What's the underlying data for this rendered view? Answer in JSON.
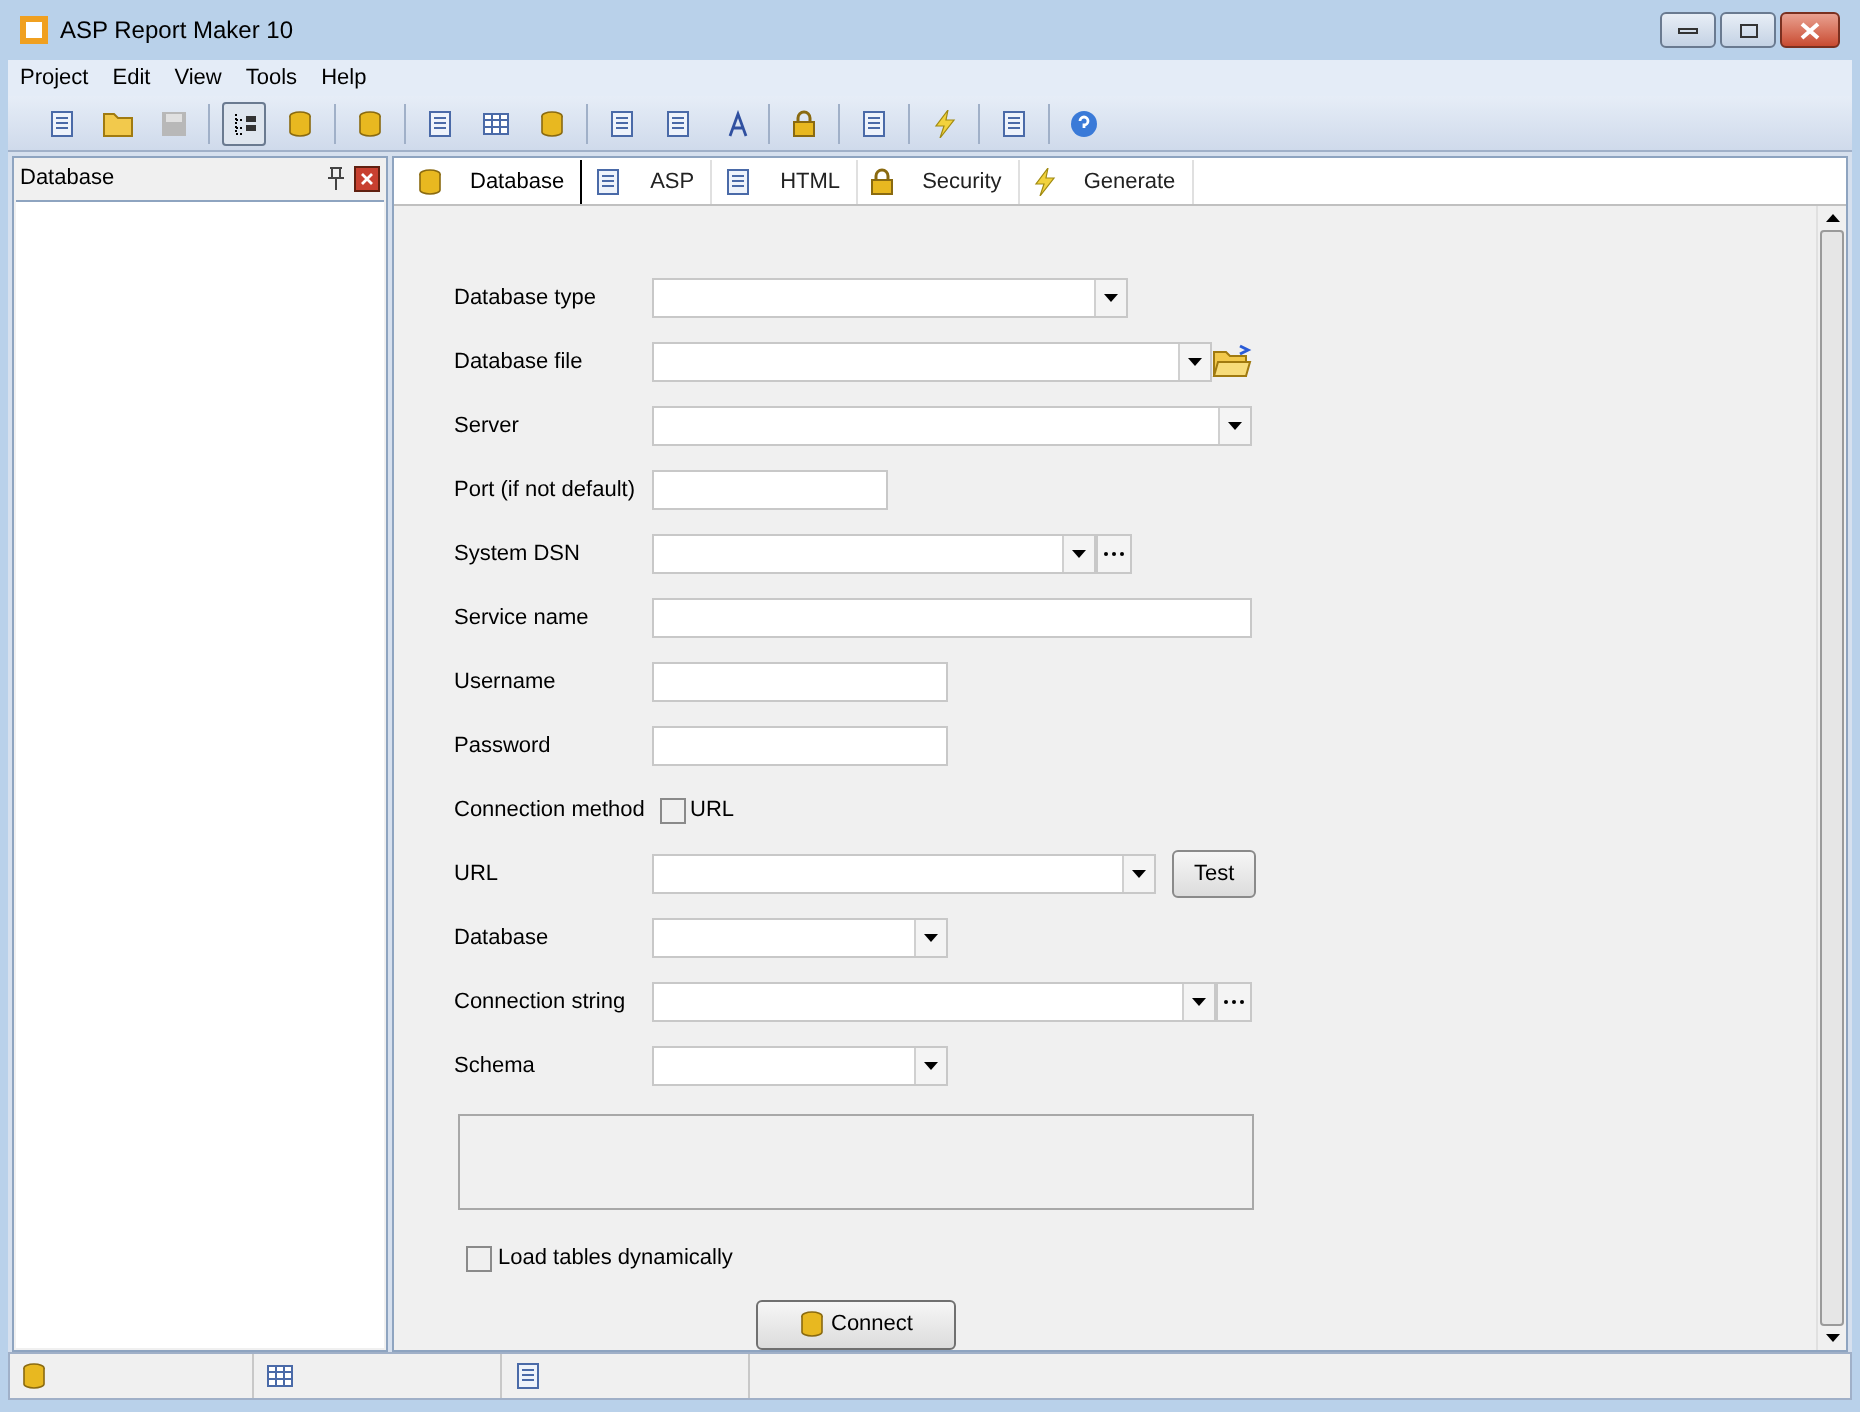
{
  "window": {
    "title": "ASP Report Maker 10"
  },
  "menu": [
    "Project",
    "Edit",
    "View",
    "Tools",
    "Help"
  ],
  "side_panel": {
    "title": "Database"
  },
  "tabs": [
    {
      "label": "Database",
      "selected": true
    },
    {
      "label": "ASP",
      "selected": false
    },
    {
      "label": "HTML",
      "selected": false
    },
    {
      "label": "Security",
      "selected": false
    },
    {
      "label": "Generate",
      "selected": false
    }
  ],
  "form": {
    "fields": [
      {
        "label": "Database type",
        "kind": "combo"
      },
      {
        "label": "Database file",
        "kind": "combo-browse"
      },
      {
        "label": "Server",
        "kind": "combo"
      },
      {
        "label": "Port (if not default)",
        "kind": "text"
      },
      {
        "label": "System DSN",
        "kind": "combo-ellipsis"
      },
      {
        "label": "Service name",
        "kind": "text"
      },
      {
        "label": "Username",
        "kind": "text"
      },
      {
        "label": "Password",
        "kind": "text"
      },
      {
        "label": "Connection method",
        "kind": "checkbox",
        "option": "URL",
        "checked": false
      },
      {
        "label": "URL",
        "kind": "combo-button",
        "button": "Test"
      },
      {
        "label": "Database",
        "kind": "combo"
      },
      {
        "label": "Connection string",
        "kind": "combo-ellipsis"
      },
      {
        "label": "Schema",
        "kind": "combo"
      }
    ],
    "load_tables": {
      "label": "Load tables dynamically",
      "checked": false
    },
    "connect_button": "Connect"
  }
}
